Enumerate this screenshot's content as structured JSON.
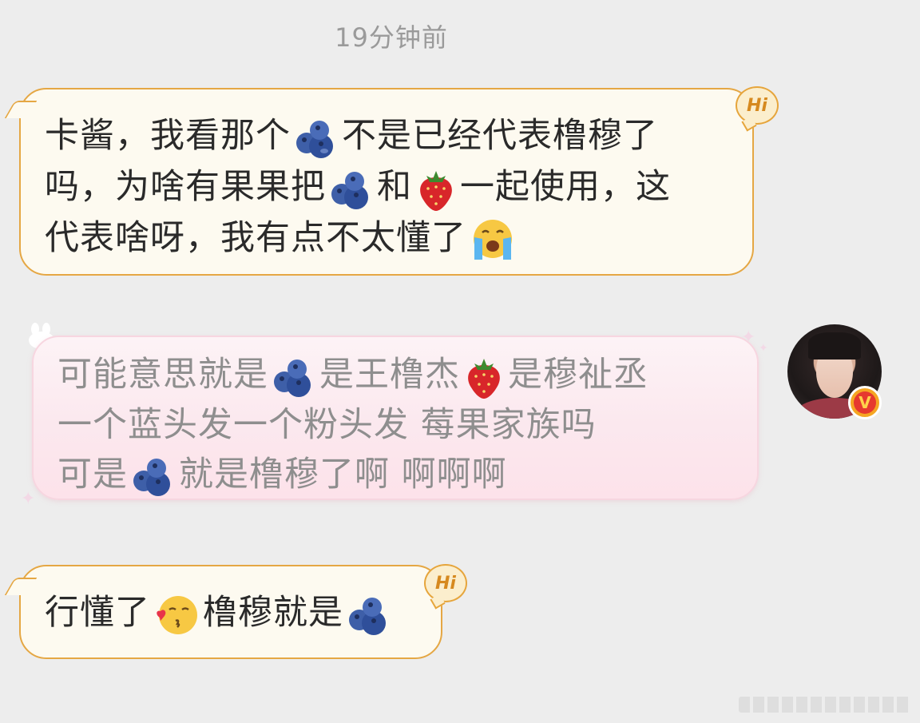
{
  "timestamp": "19分钟前",
  "messages": [
    {
      "hi_badge": "Hi",
      "lines": [
        [
          "卡酱，我看那个",
          "blueberry-emoji",
          "不是已经代表橹穆了"
        ],
        [
          "吗，为啥有果果把",
          "blueberry-emoji",
          "和",
          "strawberry-emoji",
          "一起使用，这"
        ],
        [
          "代表啥呀，我有点不太懂了",
          "crying-face-emoji"
        ]
      ]
    },
    {
      "lines": [
        [
          "可能意思就是",
          "blueberry-emoji",
          "是王橹杰",
          "strawberry-emoji",
          "是穆祉丞"
        ],
        [
          "一个蓝头发一个粉头发 莓果家族吗"
        ],
        [
          "可是",
          "blueberry-emoji",
          "就是橹穆了啊 啊啊啊"
        ]
      ]
    },
    {
      "hi_badge": "Hi",
      "lines": [
        [
          "行懂了",
          "kissing-face-emoji",
          "橹穆就是",
          "blueberry-emoji"
        ]
      ]
    }
  ],
  "avatar_badge": "V",
  "colors": {
    "background": "#ededed",
    "bubble_border": "#e5a744",
    "bubble_fill": "#fdfaf0",
    "pink_bubble_fill": "#fbe8ee",
    "timestamp_text": "#9a9a9a"
  }
}
